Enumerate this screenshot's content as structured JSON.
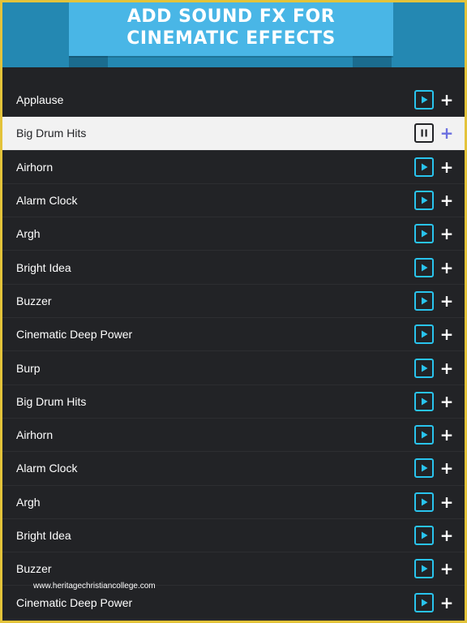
{
  "header": {
    "title": "ADD SOUND FX FOR CINEMATIC EFFECTS"
  },
  "colors": {
    "accent": "#29c4ee",
    "header_bg": "#2488b2",
    "ribbon_bg": "#49b6e6",
    "list_bg": "#222326",
    "selected_bg": "#f2f2f2",
    "selected_add": "#6b6fe0",
    "frame": "#e3c33a"
  },
  "sounds": [
    {
      "label": "Applause",
      "state": "play"
    },
    {
      "label": "Big Drum Hits",
      "state": "pause",
      "selected": true
    },
    {
      "label": "Airhorn",
      "state": "play"
    },
    {
      "label": "Alarm Clock",
      "state": "play"
    },
    {
      "label": "Argh",
      "state": "play"
    },
    {
      "label": "Bright Idea",
      "state": "play"
    },
    {
      "label": "Buzzer",
      "state": "play"
    },
    {
      "label": "Cinematic Deep Power",
      "state": "play"
    },
    {
      "label": "Burp",
      "state": "play"
    },
    {
      "label": "Big Drum Hits",
      "state": "play"
    },
    {
      "label": "Airhorn",
      "state": "play"
    },
    {
      "label": "Alarm Clock",
      "state": "play"
    },
    {
      "label": "Argh",
      "state": "play"
    },
    {
      "label": "Bright Idea",
      "state": "play"
    },
    {
      "label": "Buzzer",
      "state": "play"
    },
    {
      "label": "Cinematic Deep Power",
      "state": "play"
    }
  ],
  "icons": {
    "play": "play-icon",
    "pause": "pause-icon",
    "add": "plus-icon"
  },
  "add_symbol": "+",
  "watermark": "www.heritagechristiancollege.com"
}
